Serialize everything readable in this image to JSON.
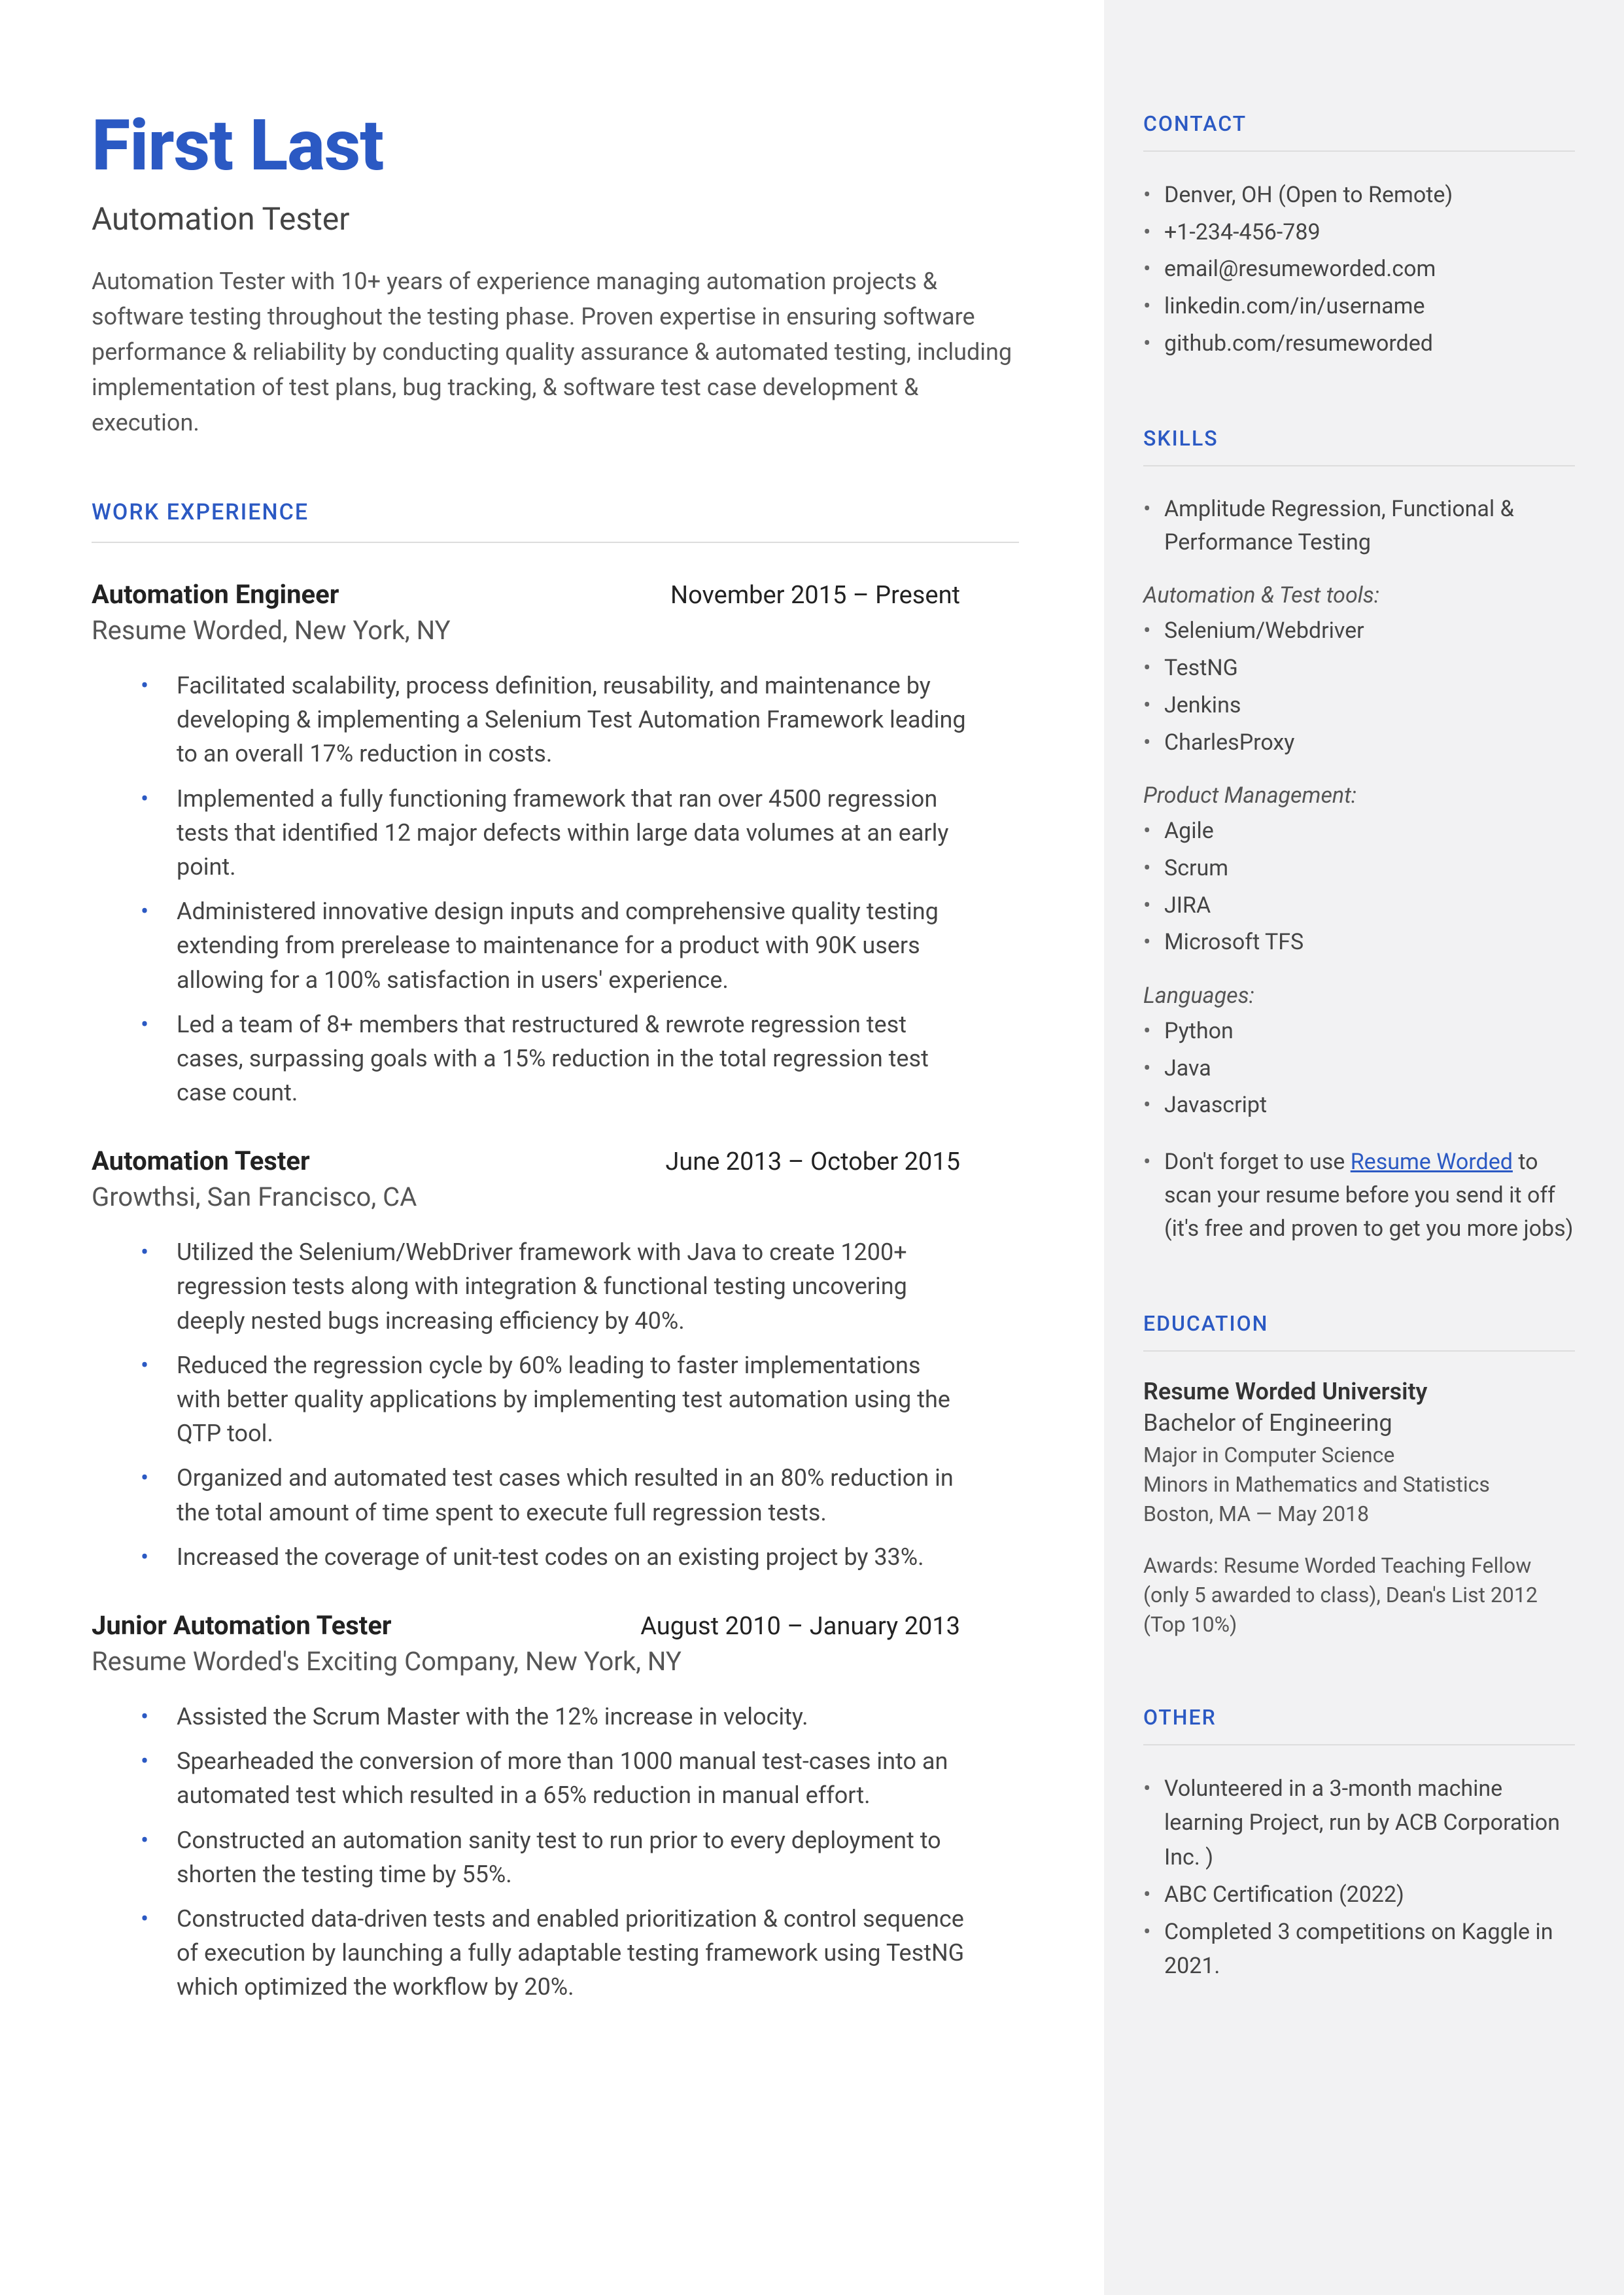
{
  "name": "First Last",
  "title": "Automation Tester",
  "summary": "Automation Tester with 10+ years of experience managing automation projects & software testing throughout the testing phase. Proven expertise in ensuring software performance & reliability by conducting quality assurance & automated testing, including implementation of test plans, bug tracking, & software test case development & execution.",
  "headings": {
    "work": "WORK EXPERIENCE",
    "contact": "CONTACT",
    "skills": "SKILLS",
    "education": "EDUCATION",
    "other": "OTHER"
  },
  "jobs": [
    {
      "title": "Automation Engineer",
      "dates": "November 2015 – Present",
      "company": "Resume Worded, New York, NY",
      "bullets": [
        "Facilitated scalability, process definition, reusability, and maintenance by developing & implementing a Selenium Test Automation Framework leading to an overall 17% reduction in costs.",
        "Implemented a fully functioning framework that ran over 4500 regression tests that identified 12 major defects within large data volumes at an early point.",
        "Administered innovative design inputs and comprehensive quality testing extending from prerelease to maintenance for a product with 90K users allowing for a 100% satisfaction in users' experience.",
        "Led a team of 8+ members that restructured & rewrote regression test cases, surpassing goals with a 15% reduction in the total regression test case count."
      ]
    },
    {
      "title": "Automation Tester",
      "dates": "June 2013 – October 2015",
      "company": "Growthsi, San Francisco, CA",
      "bullets": [
        "Utilized the Selenium/WebDriver framework with Java to create 1200+ regression tests along with integration & functional testing uncovering deeply nested bugs increasing efficiency by 40%.",
        "Reduced the regression cycle by 60% leading to faster implementations with better quality applications by implementing test automation using the QTP tool.",
        "Organized and automated test cases which resulted in an 80% reduction in the total amount of time spent to execute full regression tests.",
        "Increased the coverage of unit-test codes on an existing project by 33%."
      ]
    },
    {
      "title": "Junior Automation Tester",
      "dates": "August 2010 – January 2013",
      "company": "Resume Worded's Exciting Company, New York, NY",
      "bullets": [
        "Assisted the Scrum Master with the 12% increase in velocity.",
        "Spearheaded the conversion of more than 1000 manual test-cases into an automated test which resulted in a 65% reduction in manual effort.",
        "Constructed an automation sanity test to run prior to every deployment to shorten the testing time by 55%.",
        "Constructed data-driven tests and enabled prioritization & control sequence of execution by launching a fully adaptable testing framework using TestNG which optimized the workflow by 20%."
      ]
    }
  ],
  "contact": [
    "Denver, OH (Open to Remote)",
    "+1-234-456-789",
    "email@resumeworded.com",
    "linkedin.com/in/username",
    "github.com/resumeworded"
  ],
  "skills": {
    "lead": "Amplitude Regression, Functional & Performance Testing",
    "groups": [
      {
        "heading": "Automation & Test tools:",
        "items": [
          "Selenium/Webdriver",
          "TestNG",
          "Jenkins",
          "CharlesProxy"
        ]
      },
      {
        "heading": "Product Management:",
        "items": [
          "Agile",
          "Scrum",
          "JIRA",
          "Microsoft TFS"
        ]
      },
      {
        "heading": "Languages:",
        "items": [
          "Python",
          "Java",
          "Javascript"
        ]
      }
    ],
    "note_pre": "Don't forget to use ",
    "note_link": "Resume Worded",
    "note_post": " to scan your resume before you send it off (it's free and proven to get you more jobs)"
  },
  "education": {
    "school": "Resume Worded University",
    "degree": "Bachelor of Engineering",
    "major": "Major in Computer Science",
    "minors": "Minors in Mathematics and Statistics",
    "location": "Boston, MA — May 2018",
    "awards": "Awards: Resume Worded Teaching Fellow (only 5 awarded to class), Dean's List 2012 (Top 10%)"
  },
  "other": [
    "Volunteered in a 3-month machine learning Project, run by ACB Corporation Inc. )",
    "ABC Certification (2022)",
    "Completed 3 competitions on Kaggle in 2021."
  ]
}
